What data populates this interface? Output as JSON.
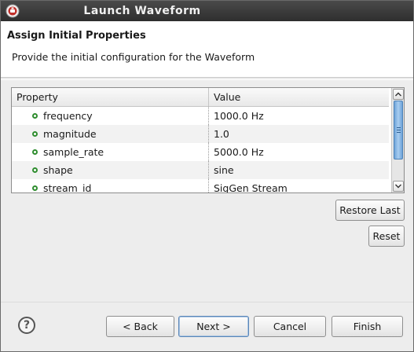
{
  "window": {
    "title": "Launch Waveform"
  },
  "banner": {
    "title": "Assign Initial Properties",
    "description": "Provide the initial configuration for the Waveform"
  },
  "table": {
    "columns": [
      "Property",
      "Value"
    ],
    "rows": [
      {
        "property": "frequency",
        "value": "1000.0 Hz"
      },
      {
        "property": "magnitude",
        "value": "1.0"
      },
      {
        "property": "sample_rate",
        "value": "5000.0 Hz"
      },
      {
        "property": "shape",
        "value": "sine"
      },
      {
        "property": "stream_id",
        "value": "SigGen Stream"
      }
    ]
  },
  "side_buttons": {
    "restore_last": "Restore Last",
    "reset": "Reset"
  },
  "footer": {
    "help_glyph": "?",
    "back": "< Back",
    "next": "Next >",
    "cancel": "Cancel",
    "finish": "Finish"
  },
  "icons": {
    "title": "app-logo-icon",
    "help": "help-icon",
    "bullet": "property-bullet-icon"
  },
  "colors": {
    "titlebar": "#2e2e2e",
    "bullet": "#2f8d2f",
    "scroll_thumb": "#6ea4d9"
  }
}
